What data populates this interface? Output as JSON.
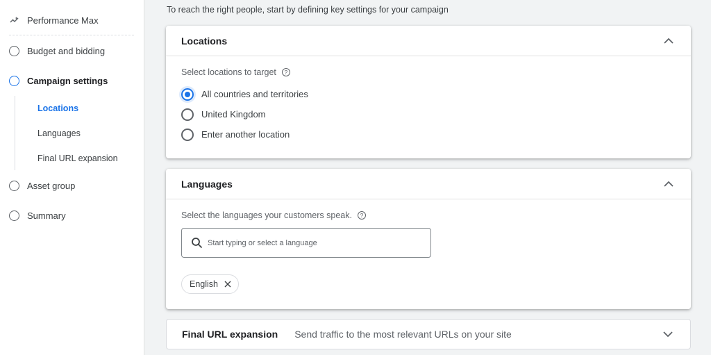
{
  "sidebar": {
    "items": [
      {
        "label": "Performance Max",
        "icon": "performance-max-icon"
      },
      {
        "label": "Budget and bidding",
        "icon": "step-circle-icon"
      },
      {
        "label": "Campaign settings",
        "icon": "step-circle-icon",
        "active": true
      },
      {
        "label": "Asset group",
        "icon": "step-circle-icon"
      },
      {
        "label": "Summary",
        "icon": "step-circle-icon"
      }
    ],
    "sub_items": [
      {
        "label": "Locations",
        "active": true
      },
      {
        "label": "Languages"
      },
      {
        "label": "Final URL expansion"
      }
    ]
  },
  "main": {
    "intro": "To reach the right people, start by defining key settings for your campaign",
    "locations": {
      "title": "Locations",
      "field_label": "Select locations to target",
      "help_icon": "?",
      "options": [
        {
          "label": "All countries and territories",
          "checked": true
        },
        {
          "label": "United Kingdom",
          "checked": false
        },
        {
          "label": "Enter another location",
          "checked": false
        }
      ]
    },
    "languages": {
      "title": "Languages",
      "field_label": "Select the languages your customers speak.",
      "help_icon": "?",
      "search_placeholder": "Start typing or select a language",
      "search_value": "",
      "selected": [
        "English"
      ]
    },
    "final_url": {
      "title": "Final URL expansion",
      "subtitle": "Send traffic to the most relevant URLs on your site"
    }
  },
  "colors": {
    "accent": "#1a73e8",
    "background": "#f1f3f4"
  }
}
